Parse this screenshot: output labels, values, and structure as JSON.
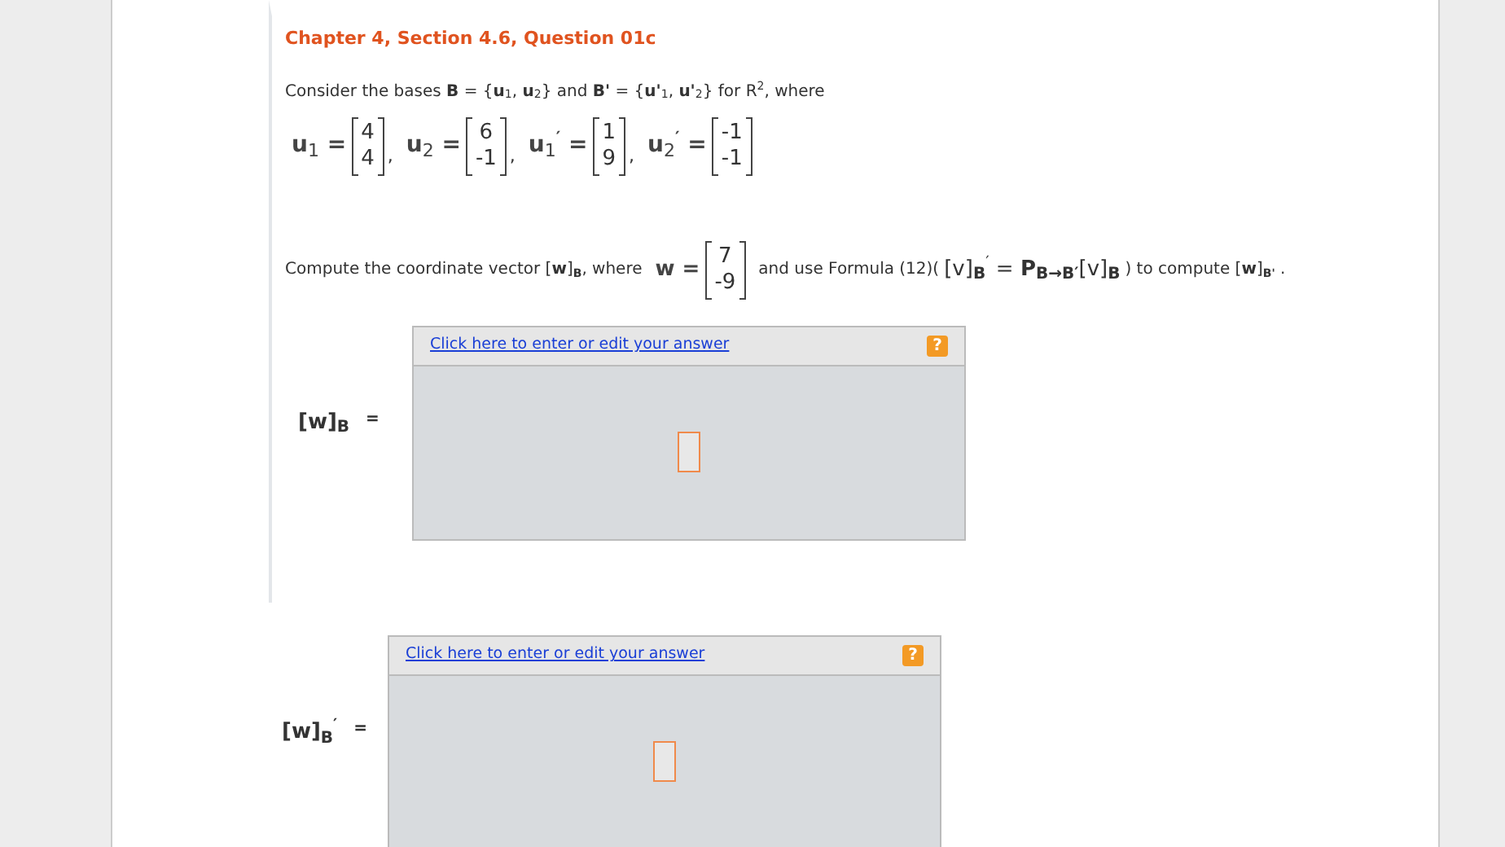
{
  "question": {
    "title": "Chapter 4, Section 4.6, Question 01c",
    "intro": "Consider the bases **B** = {**u**$_{1}$, **u**$_{2}$} and **B'** = {**u'**$_{1}$, **u'**$_{2}$} for R$^{2}$, where",
    "vectors": [
      {
        "label": "u$_{1}$ =",
        "entries": [
          "4",
          "4"
        ],
        "separator": ","
      },
      {
        "label": "u$_{2}$ =",
        "entries": [
          "6",
          "-1"
        ],
        "separator": ","
      },
      {
        "label": "u$_{1}$$^{′}$ =",
        "entries": [
          "1",
          "9"
        ],
        "separator": ","
      },
      {
        "label": "u$_{2}$$^{′}$ =",
        "entries": [
          "-1",
          "-1"
        ]
      }
    ],
    "compute_before": "Compute the coordinate vector [**w**]$_{B}$, where",
    "w_vector": {
      "label": "w =",
      "entries": [
        "7",
        "-9"
      ]
    },
    "compute_middle": "and use Formula (12)(",
    "formula": "[v]$_{B}$$^{′}$ = **P**$_{B→B′}$[v]$_{B}$",
    "compute_after": ") to compute [**w**]$_{B'}$ ."
  },
  "answers": [
    {
      "label": "[w]$_{B}$",
      "equals": "=",
      "link": "Click here to enter or edit your answer",
      "help": "?"
    },
    {
      "label": "[w]$_{B}$$^{′}$",
      "equals": "=",
      "link": "Click here to enter or edit your answer",
      "help": "?"
    }
  ]
}
